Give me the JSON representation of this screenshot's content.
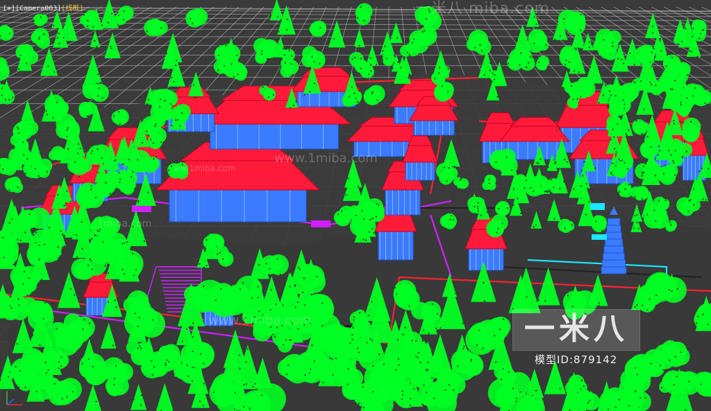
{
  "viewport": {
    "label_plus": "[+]",
    "label_camera": "[Camera003]",
    "label_mode": "[线框]"
  },
  "watermarks": {
    "top": "一米八 miba.com",
    "middle_1": "www.1miba.com",
    "middle_2": "1miba.com",
    "middle_3": "ww.1miba.com",
    "bottom": "www.1miba.com"
  },
  "brand": {
    "logo": "一米八",
    "model_id": "模型ID:879142"
  },
  "colors": {
    "background": "#3a3a3a",
    "grid": "#d8d8d8",
    "roof": "#ff1a3a",
    "building": "#3a7bff",
    "tree": "#00ff22",
    "magenta": "#d020ff",
    "cyan": "#19e6ff",
    "wall_red": "#ff2030"
  },
  "icons": [
    "axis-gizmo-icon"
  ]
}
